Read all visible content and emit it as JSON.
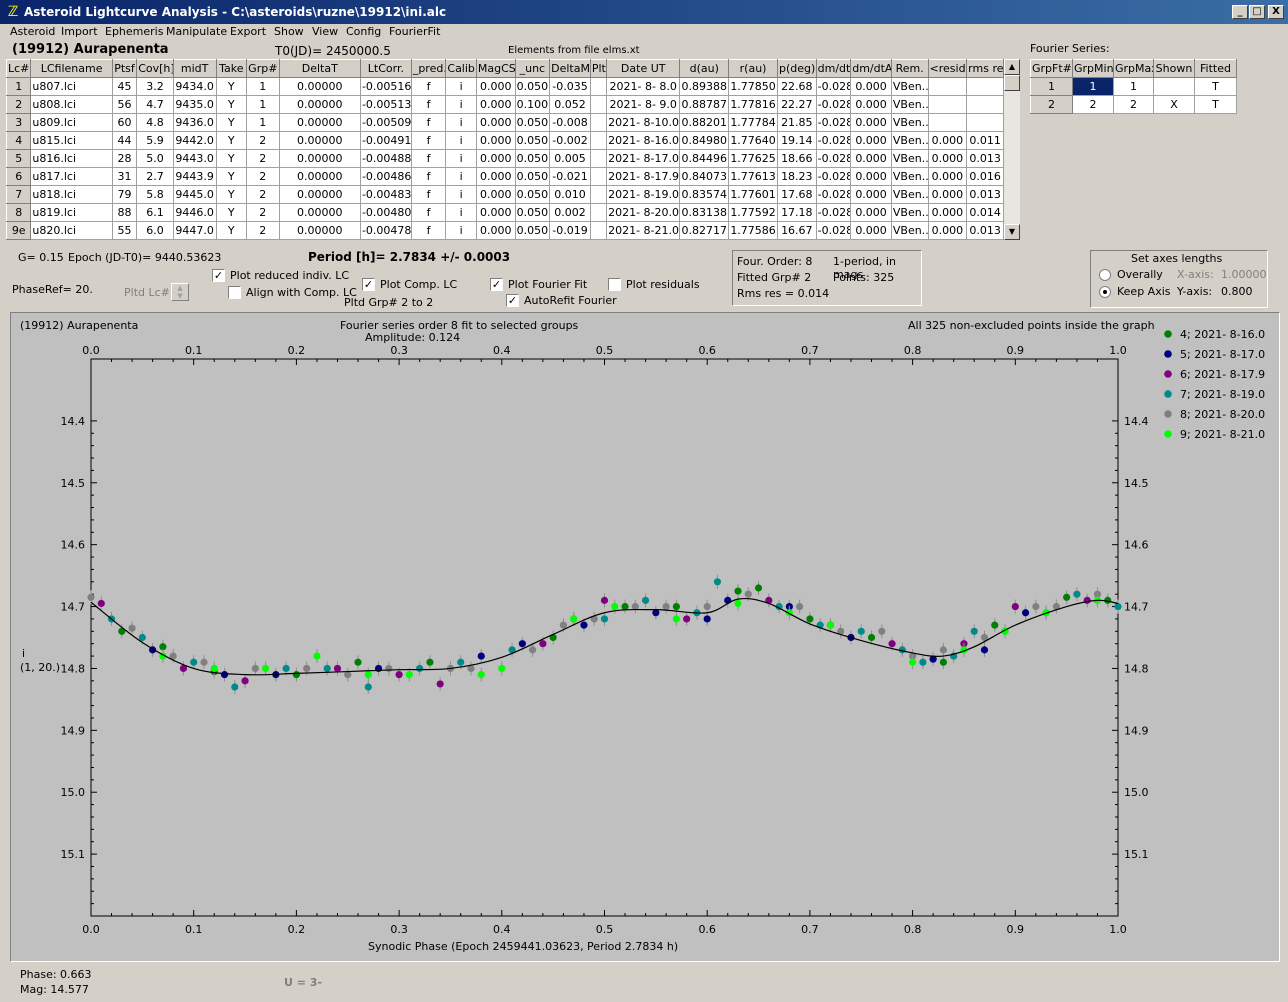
{
  "window": {
    "title": "Asteroid Lightcurve Analysis - C:\\asteroids\\ruzne\\19912\\ini.alc",
    "minimize": "_",
    "maximize": "□",
    "close": "X"
  },
  "menu": [
    "Asteroid",
    "Import",
    "Ephemeris",
    "Manipulate",
    "Export",
    "Show",
    "View",
    "Config",
    "FourierFit"
  ],
  "header": {
    "asteroid": "(19912) Aurapenenta",
    "t0": "T0(JD)= 2450000.5",
    "elements": "Elements from file elms.xt"
  },
  "table": {
    "columns": [
      "Lc#",
      "LCfilename",
      "Ptsf",
      "Cov[h]",
      "midT",
      "Take",
      "Grp#",
      "DeltaT",
      "LtCorr.",
      "_pred.",
      "Calib.",
      "MagCS",
      "_unc",
      "DeltaM",
      "Plt",
      "Date UT",
      "d(au)",
      "r(au)",
      "p(deg)",
      "dm/dt",
      "dm/dtA",
      "Rem.",
      "<resid>",
      "rms res"
    ],
    "rows": [
      [
        "1",
        "u807.lci",
        "45",
        "3.2",
        "9434.0",
        "Y",
        "1",
        "0.00000",
        "-0.00516",
        "f",
        "i",
        "0.000",
        "0.050",
        "-0.035",
        "",
        "2021- 8- 8.0",
        "0.89388",
        "1.77850",
        "22.68",
        "-0.028",
        "0.000",
        "VBen..",
        "",
        ""
      ],
      [
        "2",
        "u808.lci",
        "56",
        "4.7",
        "9435.0",
        "Y",
        "1",
        "0.00000",
        "-0.00513",
        "f",
        "i",
        "0.000",
        "0.100",
        "0.052",
        "",
        "2021- 8- 9.0",
        "0.88787",
        "1.77816",
        "22.27",
        "-0.028",
        "0.000",
        "VBen..",
        "",
        ""
      ],
      [
        "3",
        "u809.lci",
        "60",
        "4.8",
        "9436.0",
        "Y",
        "1",
        "0.00000",
        "-0.00509",
        "f",
        "i",
        "0.000",
        "0.050",
        "-0.008",
        "",
        "2021- 8-10.0",
        "0.88201",
        "1.77784",
        "21.85",
        "-0.028",
        "0.000",
        "VBen..",
        "",
        ""
      ],
      [
        "4",
        "u815.lci",
        "44",
        "5.9",
        "9442.0",
        "Y",
        "2",
        "0.00000",
        "-0.00491",
        "f",
        "i",
        "0.000",
        "0.050",
        "-0.002",
        "",
        "2021- 8-16.0",
        "0.84980",
        "1.77640",
        "19.14",
        "-0.028",
        "0.000",
        "VBen..",
        "0.000",
        "0.011"
      ],
      [
        "5",
        "u816.lci",
        "28",
        "5.0",
        "9443.0",
        "Y",
        "2",
        "0.00000",
        "-0.00488",
        "f",
        "i",
        "0.000",
        "0.050",
        "0.005",
        "",
        "2021- 8-17.0",
        "0.84496",
        "1.77625",
        "18.66",
        "-0.028",
        "0.000",
        "VBen..",
        "0.000",
        "0.013"
      ],
      [
        "6",
        "u817.lci",
        "31",
        "2.7",
        "9443.9",
        "Y",
        "2",
        "0.00000",
        "-0.00486",
        "f",
        "i",
        "0.000",
        "0.050",
        "-0.021",
        "",
        "2021- 8-17.9",
        "0.84073",
        "1.77613",
        "18.23",
        "-0.028",
        "0.000",
        "VBen..",
        "0.000",
        "0.016"
      ],
      [
        "7",
        "u818.lci",
        "79",
        "5.8",
        "9445.0",
        "Y",
        "2",
        "0.00000",
        "-0.00483",
        "f",
        "i",
        "0.000",
        "0.050",
        "0.010",
        "",
        "2021- 8-19.0",
        "0.83574",
        "1.77601",
        "17.68",
        "-0.028",
        "0.000",
        "VBen..",
        "0.000",
        "0.013"
      ],
      [
        "8",
        "u819.lci",
        "88",
        "6.1",
        "9446.0",
        "Y",
        "2",
        "0.00000",
        "-0.00480",
        "f",
        "i",
        "0.000",
        "0.050",
        "0.002",
        "",
        "2021- 8-20.0",
        "0.83138",
        "1.77592",
        "17.18",
        "-0.028",
        "0.000",
        "VBen..",
        "0.000",
        "0.014"
      ],
      [
        "9e",
        "u820.lci",
        "55",
        "6.0",
        "9447.0",
        "Y",
        "2",
        "0.00000",
        "-0.00478",
        "f",
        "i",
        "0.000",
        "0.050",
        "-0.019",
        "",
        "2021- 8-21.0",
        "0.82717",
        "1.77586",
        "16.67",
        "-0.028",
        "0.000",
        "VBen..",
        "0.000",
        "0.013"
      ]
    ]
  },
  "fourier_table": {
    "title": "Fourier Series:",
    "columns": [
      "GrpFt#",
      "GrpMin",
      "GrpMax",
      "Shown",
      "Fitted"
    ],
    "rows": [
      [
        "1",
        "1",
        "1",
        "",
        "T"
      ],
      [
        "2",
        "2",
        "2",
        "X",
        "T"
      ]
    ]
  },
  "info": {
    "g": "G= 0.15",
    "epoch": "Epoch (JD-T0)= 9440.53623",
    "period": "Period [h]= 2.7834 +/- 0.0003",
    "phaseref": "PhaseRef= 20.",
    "pltd_lc": "Pltd Lc#:",
    "pltd_grp": "Pltd Grp#  2   to   2"
  },
  "options": {
    "plot_reduced": "Plot reduced indiv. LC",
    "align_comp": "Align with Comp. LC",
    "plot_comp": "Plot Comp. LC",
    "plot_fourier": "Plot Fourier Fit",
    "autorefit": "AutoRefit Fourier",
    "plot_residuals": "Plot residuals"
  },
  "fit_box": {
    "order": "Four. Order:  8",
    "mode": "1-period, in mags",
    "fitted": "Fitted Grp# 2",
    "points": "Points: 325",
    "rms": "Rms res     = 0.014"
  },
  "axes_box": {
    "title": "Set axes lengths",
    "overally": "Overally",
    "keep": "Keep Axis",
    "xaxis_label": "X-axis:",
    "xaxis_val": "1.00000",
    "yaxis_label": "Y-axis:",
    "yaxis_val": "0.800"
  },
  "plot": {
    "name": "(19912) Aurapenenta",
    "fit_title": "Fourier series order 8 fit to selected groups",
    "amplitude": "Amplitude: 0.124",
    "points_note": "All 325 non-excluded points inside the graph",
    "ylabel": "i",
    "ylabel2": "(1, 20.)",
    "xlabel": "Synodic Phase (Epoch 2459441.03623, Period 2.7834 h)"
  },
  "status": {
    "phase": "Phase:  0.663",
    "mag": "Mag:    14.577",
    "u": "U = 3-"
  },
  "chart_data": {
    "type": "scatter",
    "xlim": [
      0,
      1
    ],
    "ylim": [
      15.2,
      14.3
    ],
    "inverted_y": true,
    "xticks": [
      "0.0",
      "0.1",
      "0.2",
      "0.3",
      "0.4",
      "0.5",
      "0.6",
      "0.7",
      "0.8",
      "0.9",
      "1.0"
    ],
    "yticks": [
      "14.4",
      "14.5",
      "14.6",
      "14.7",
      "14.8",
      "14.9",
      "15.0",
      "15.1"
    ],
    "fit_curve": [
      [
        0,
        14.693
      ],
      [
        0.05,
        14.758
      ],
      [
        0.1,
        14.8
      ],
      [
        0.15,
        14.81
      ],
      [
        0.2,
        14.808
      ],
      [
        0.25,
        14.805
      ],
      [
        0.3,
        14.802
      ],
      [
        0.35,
        14.8
      ],
      [
        0.4,
        14.782
      ],
      [
        0.45,
        14.745
      ],
      [
        0.5,
        14.71
      ],
      [
        0.55,
        14.705
      ],
      [
        0.6,
        14.71
      ],
      [
        0.63,
        14.688
      ],
      [
        0.66,
        14.695
      ],
      [
        0.7,
        14.728
      ],
      [
        0.75,
        14.755
      ],
      [
        0.8,
        14.775
      ],
      [
        0.83,
        14.78
      ],
      [
        0.86,
        14.765
      ],
      [
        0.9,
        14.73
      ],
      [
        0.95,
        14.7
      ],
      [
        0.98,
        14.69
      ],
      [
        1,
        14.695
      ]
    ],
    "series": [
      {
        "name": "4; 2021- 8-16.0",
        "color": "#008000",
        "points": [
          [
            0.03,
            14.74
          ],
          [
            0.07,
            14.765
          ],
          [
            0.12,
            14.805
          ],
          [
            0.2,
            14.81
          ],
          [
            0.26,
            14.79
          ],
          [
            0.33,
            14.79
          ],
          [
            0.45,
            14.75
          ],
          [
            0.52,
            14.7
          ],
          [
            0.57,
            14.7
          ],
          [
            0.63,
            14.675
          ],
          [
            0.65,
            14.67
          ],
          [
            0.7,
            14.72
          ],
          [
            0.76,
            14.75
          ],
          [
            0.83,
            14.79
          ],
          [
            0.88,
            14.73
          ],
          [
            0.95,
            14.685
          ],
          [
            0.99,
            14.69
          ]
        ]
      },
      {
        "name": "5; 2021- 8-17.0",
        "color": "#000080",
        "points": [
          [
            0.06,
            14.77
          ],
          [
            0.13,
            14.81
          ],
          [
            0.18,
            14.81
          ],
          [
            0.28,
            14.8
          ],
          [
            0.38,
            14.78
          ],
          [
            0.42,
            14.76
          ],
          [
            0.48,
            14.73
          ],
          [
            0.55,
            14.71
          ],
          [
            0.6,
            14.72
          ],
          [
            0.62,
            14.69
          ],
          [
            0.68,
            14.7
          ],
          [
            0.74,
            14.75
          ],
          [
            0.82,
            14.785
          ],
          [
            0.87,
            14.77
          ],
          [
            0.91,
            14.71
          ]
        ]
      },
      {
        "name": "6; 2021- 8-17.9",
        "color": "#800080",
        "points": [
          [
            0.01,
            14.695
          ],
          [
            0.09,
            14.8
          ],
          [
            0.15,
            14.82
          ],
          [
            0.24,
            14.8
          ],
          [
            0.3,
            14.81
          ],
          [
            0.34,
            14.825
          ],
          [
            0.44,
            14.76
          ],
          [
            0.5,
            14.69
          ],
          [
            0.58,
            14.72
          ],
          [
            0.66,
            14.69
          ],
          [
            0.72,
            14.73
          ],
          [
            0.78,
            14.76
          ],
          [
            0.85,
            14.76
          ],
          [
            0.9,
            14.7
          ],
          [
            0.97,
            14.69
          ]
        ]
      },
      {
        "name": "7; 2021- 8-19.0",
        "color": "#008b8b",
        "points": [
          [
            0.02,
            14.72
          ],
          [
            0.05,
            14.75
          ],
          [
            0.1,
            14.79
          ],
          [
            0.14,
            14.83
          ],
          [
            0.19,
            14.8
          ],
          [
            0.23,
            14.8
          ],
          [
            0.27,
            14.83
          ],
          [
            0.32,
            14.8
          ],
          [
            0.36,
            14.79
          ],
          [
            0.41,
            14.77
          ],
          [
            0.47,
            14.72
          ],
          [
            0.5,
            14.72
          ],
          [
            0.54,
            14.69
          ],
          [
            0.59,
            14.71
          ],
          [
            0.61,
            14.66
          ],
          [
            0.67,
            14.7
          ],
          [
            0.71,
            14.73
          ],
          [
            0.75,
            14.74
          ],
          [
            0.79,
            14.77
          ],
          [
            0.81,
            14.79
          ],
          [
            0.84,
            14.78
          ],
          [
            0.86,
            14.74
          ],
          [
            0.89,
            14.74
          ],
          [
            0.93,
            14.71
          ],
          [
            0.96,
            14.68
          ],
          [
            1.0,
            14.7
          ]
        ]
      },
      {
        "name": "8; 2021- 8-20.0",
        "color": "#808080",
        "points": [
          [
            0.0,
            14.685
          ],
          [
            0.04,
            14.735
          ],
          [
            0.08,
            14.78
          ],
          [
            0.11,
            14.79
          ],
          [
            0.16,
            14.8
          ],
          [
            0.21,
            14.8
          ],
          [
            0.25,
            14.81
          ],
          [
            0.29,
            14.8
          ],
          [
            0.35,
            14.8
          ],
          [
            0.37,
            14.8
          ],
          [
            0.43,
            14.77
          ],
          [
            0.46,
            14.73
          ],
          [
            0.49,
            14.72
          ],
          [
            0.53,
            14.7
          ],
          [
            0.56,
            14.7
          ],
          [
            0.6,
            14.7
          ],
          [
            0.64,
            14.68
          ],
          [
            0.69,
            14.7
          ],
          [
            0.73,
            14.74
          ],
          [
            0.77,
            14.74
          ],
          [
            0.8,
            14.78
          ],
          [
            0.83,
            14.77
          ],
          [
            0.87,
            14.75
          ],
          [
            0.92,
            14.7
          ],
          [
            0.94,
            14.7
          ],
          [
            0.98,
            14.68
          ]
        ]
      },
      {
        "name": "9; 2021- 8-21.0",
        "color": "#00ff00",
        "points": [
          [
            0.07,
            14.78
          ],
          [
            0.12,
            14.8
          ],
          [
            0.17,
            14.8
          ],
          [
            0.22,
            14.78
          ],
          [
            0.27,
            14.81
          ],
          [
            0.31,
            14.81
          ],
          [
            0.38,
            14.81
          ],
          [
            0.4,
            14.8
          ],
          [
            0.47,
            14.72
          ],
          [
            0.51,
            14.7
          ],
          [
            0.57,
            14.72
          ],
          [
            0.63,
            14.695
          ],
          [
            0.68,
            14.71
          ],
          [
            0.72,
            14.73
          ],
          [
            0.8,
            14.79
          ],
          [
            0.85,
            14.77
          ],
          [
            0.89,
            14.74
          ],
          [
            0.93,
            14.71
          ],
          [
            0.98,
            14.69
          ]
        ]
      }
    ]
  }
}
